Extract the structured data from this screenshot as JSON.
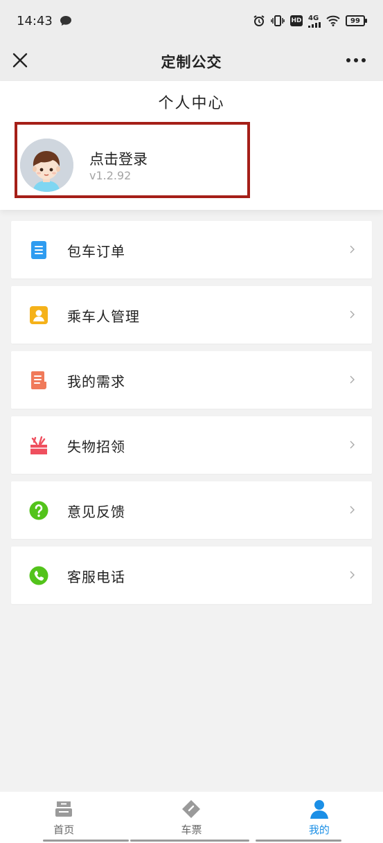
{
  "status_bar": {
    "time": "14:43",
    "network": "4G",
    "hd": "HD",
    "battery": "99"
  },
  "nav": {
    "title": "定制公交"
  },
  "profile": {
    "title": "个人中心",
    "login_text": "点击登录",
    "version": "v1.2.92"
  },
  "menu": [
    {
      "label": "包车订单",
      "icon": "order-document-icon",
      "color": "#2f9cf0"
    },
    {
      "label": "乘车人管理",
      "icon": "passenger-person-icon",
      "color": "#f5b21a"
    },
    {
      "label": "我的需求",
      "icon": "request-list-icon",
      "color": "#f07a5a"
    },
    {
      "label": "失物招领",
      "icon": "lost-found-box-icon",
      "color": "#ef4f5e"
    },
    {
      "label": "意见反馈",
      "icon": "feedback-question-icon",
      "color": "#53c31b"
    },
    {
      "label": "客服电话",
      "icon": "phone-icon",
      "color": "#53c31b"
    }
  ],
  "tabs": [
    {
      "label": "首页",
      "icon": "home-bus-icon",
      "active": false
    },
    {
      "label": "车票",
      "icon": "ticket-icon",
      "active": false
    },
    {
      "label": "我的",
      "icon": "profile-person-icon",
      "active": true
    }
  ],
  "colors": {
    "accent": "#1b8fe6",
    "highlight_border": "#a51f18",
    "background": "#f2f2f2"
  }
}
